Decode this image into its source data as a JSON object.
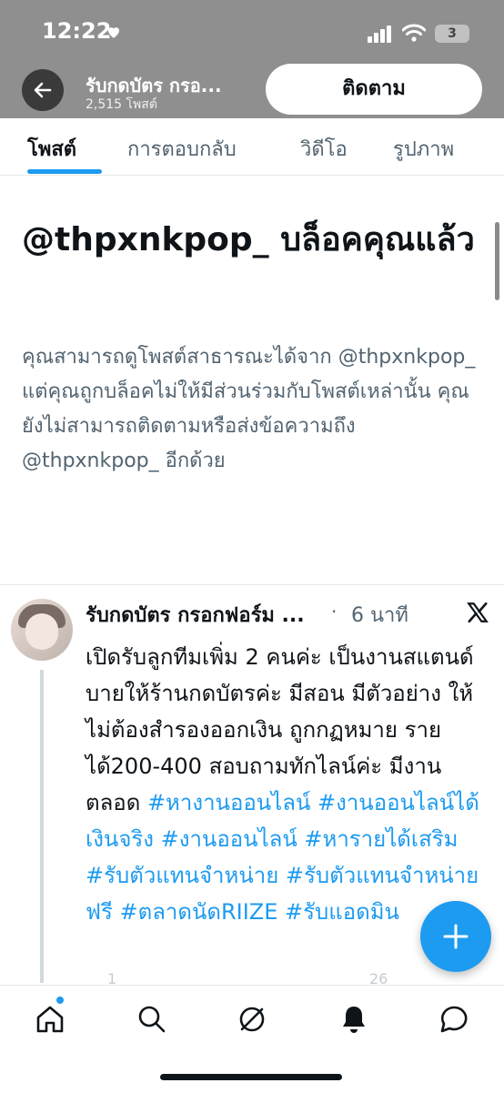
{
  "status_bar": {
    "time": "12:22",
    "battery": "3"
  },
  "header": {
    "title": "รับกดบัตร กรอ...",
    "subtitle": "2,515 โพสต์",
    "follow_label": "ติดตาม"
  },
  "tabs": [
    {
      "label": "โพสต์",
      "active": true
    },
    {
      "label": "การตอบกลับ",
      "active": false
    },
    {
      "label": "วิดีโอ",
      "active": false
    },
    {
      "label": "รูปภาพ",
      "active": false
    }
  ],
  "blocked_notice": {
    "title": "@thpxnkpop_ บล็อคคุณแล้ว",
    "description": "คุณสามารถดูโพสต์สาธารณะได้จาก @thpxnkpop_ แต่คุณถูกบล็อคไม่ให้มีส่วนร่วมกับโพสต์เหล่านั้น คุณยังไม่สามารถติดตามหรือส่งข้อความถึง @thpxnkpop_ อีกด้วย"
  },
  "tweet": {
    "name": "รับกดบัตร กรอกฟอร์ม ...",
    "separator": "·",
    "time": "6 นาที",
    "body_text": "เปิดรับลูกทีมเพิ่ม 2 คนค่ะ เป็นงานสแตนด์บายให้ร้านกดบัตรค่ะ มีสอน มีตัวอย่าง ให้ไม่ต้องสำรองออกเงิน ถูกกฏหมาย รายได้200-400 สอบถามทักไลน์ค่ะ มีงานตลอด",
    "hashtags": "#หางานออนไลน์ #งานออนไลน์ได้เงินจริง #งานออนไลน์ #หารายได้เสริม #รับตัวแทนจำหน่าย #รับตัวแทนจำหน่ายฟรี #ตลาดนัดRIIZE #รับแอดมิน",
    "replies": "1",
    "views": "26"
  },
  "colors": {
    "accent": "#1d9bf0",
    "banner": "#8f8f8f",
    "muted_text": "#536471"
  },
  "icons": {
    "back": "back-arrow-icon",
    "x_logo": "x-logo-icon",
    "compose": "plus-icon",
    "nav": [
      "home-icon",
      "search-icon",
      "grok-icon",
      "bell-icon",
      "messages-icon"
    ]
  }
}
